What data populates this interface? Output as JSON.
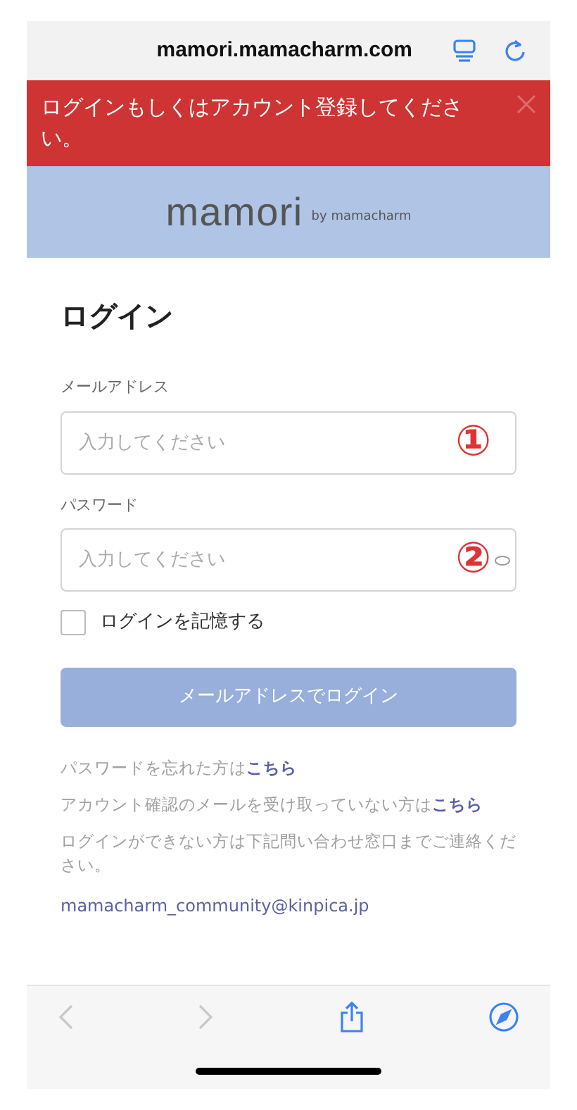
{
  "browser": {
    "url": "mamori.mamacharm.com"
  },
  "alert": {
    "message": "ログインもしくはアカウント登録してください。"
  },
  "logo": {
    "name": "mamori",
    "tagline": "by mamacharm"
  },
  "title": "ログイン",
  "fields": [
    {
      "label": "メールアドレス",
      "placeholder": "入力してください",
      "annotation": "①",
      "password": false
    },
    {
      "label": "パスワード",
      "placeholder": "入力してください",
      "annotation": "②",
      "password": true
    }
  ],
  "remember": {
    "label": "ログインを記憶する",
    "checked": false
  },
  "submit": {
    "label": "メールアドレスでログイン",
    "disabled": true
  },
  "help": [
    {
      "text": "パスワードを忘れた方は",
      "link": "こちら"
    },
    {
      "text": "アカウント確認のメールを受け取っていない方は",
      "link": "こちら"
    },
    {
      "text": "ログインができない方は下記問い合わせ窓口までご連絡ください。"
    }
  ],
  "contact_email": "mamacharm_community@kinpica.jp",
  "toolbar": {
    "back_disabled": true,
    "forward_disabled": true
  }
}
